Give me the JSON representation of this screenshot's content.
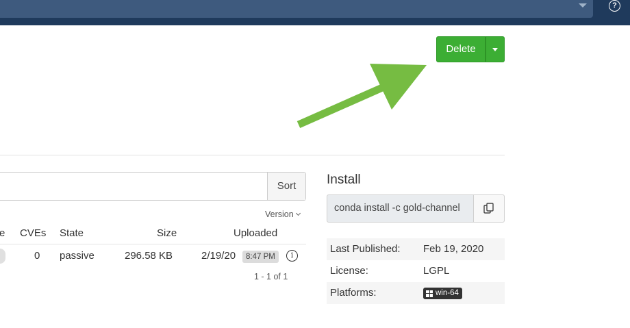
{
  "header": {
    "help_icon": "question-circle-icon",
    "help_glyph": "?"
  },
  "actions": {
    "delete_label": "Delete"
  },
  "annotation": {
    "arrow_color": "#76bc42"
  },
  "files": {
    "sort_label": "Sort",
    "version_label": "Version",
    "columns": [
      "e",
      "CVEs",
      "State",
      "Size",
      "Uploaded"
    ],
    "rows": [
      {
        "cves": "0",
        "state": "passive",
        "size": "296.58 KB",
        "uploaded_date": "2/19/20",
        "uploaded_time": "8:47 PM"
      }
    ],
    "pagination": "1 - 1 of 1"
  },
  "install": {
    "title": "Install",
    "command": "conda install -c gold-channel",
    "copy_icon": "copy-icon"
  },
  "metadata": {
    "last_published_label": "Last Published:",
    "last_published_value": "Feb 19, 2020",
    "license_label": "License:",
    "license_value": "LGPL",
    "platforms_label": "Platforms:",
    "platforms": [
      "win-64"
    ]
  },
  "colors": {
    "topbar": "#1f3a5c",
    "primary_green": "#3cae34"
  }
}
